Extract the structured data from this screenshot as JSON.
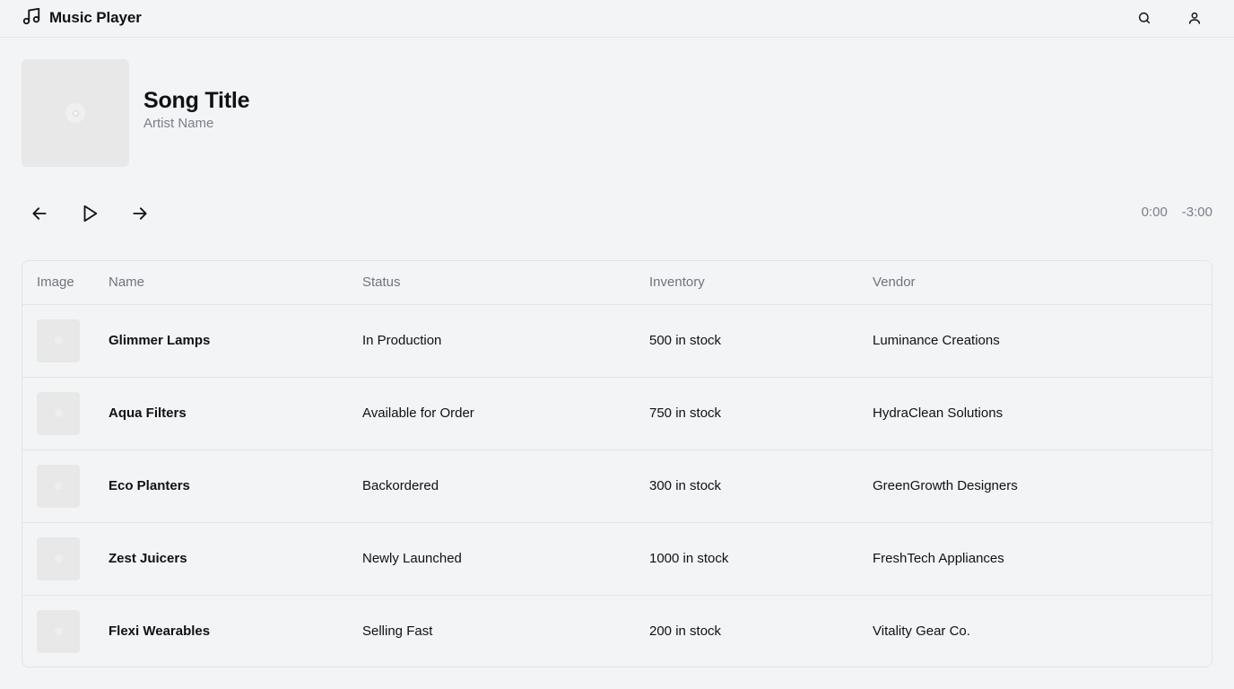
{
  "header": {
    "title": "Music Player",
    "logo_icon": "music-note-icon",
    "search_icon": "search-icon",
    "user_icon": "user-icon"
  },
  "now_playing": {
    "song_title": "Song Title",
    "artist": "Artist Name",
    "cover_icon": "disc-icon"
  },
  "controls": {
    "prev_icon": "arrow-left-icon",
    "play_icon": "play-icon",
    "next_icon": "arrow-right-icon",
    "elapsed": "0:00",
    "remaining": "-3:00"
  },
  "table": {
    "columns": [
      "Image",
      "Name",
      "Status",
      "Inventory",
      "Vendor"
    ],
    "rows": [
      {
        "name": "Glimmer Lamps",
        "status": "In Production",
        "inventory": "500 in stock",
        "vendor": "Luminance Creations"
      },
      {
        "name": "Aqua Filters",
        "status": "Available for Order",
        "inventory": "750 in stock",
        "vendor": "HydraClean Solutions"
      },
      {
        "name": "Eco Planters",
        "status": "Backordered",
        "inventory": "300 in stock",
        "vendor": "GreenGrowth Designers"
      },
      {
        "name": "Zest Juicers",
        "status": "Newly Launched",
        "inventory": "1000 in stock",
        "vendor": "FreshTech Appliances"
      },
      {
        "name": "Flexi Wearables",
        "status": "Selling Fast",
        "inventory": "200 in stock",
        "vendor": "Vitality Gear Co."
      }
    ]
  }
}
